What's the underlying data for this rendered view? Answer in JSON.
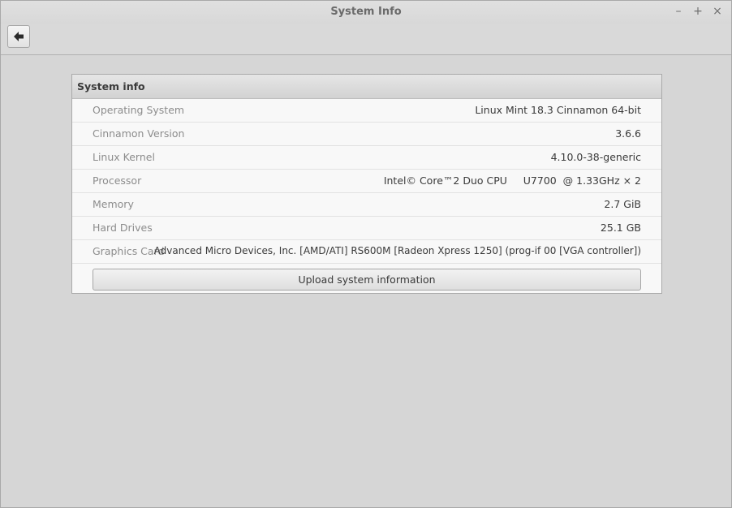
{
  "window": {
    "title": "System Info",
    "controls": {
      "minimize": "–",
      "maximize": "+",
      "close": "×"
    }
  },
  "toolbar": {
    "back_icon": "back-arrow-icon"
  },
  "panel": {
    "header": "System info",
    "rows": [
      {
        "label": "Operating System",
        "value": "Linux Mint 18.3 Cinnamon 64-bit"
      },
      {
        "label": "Cinnamon Version",
        "value": "3.6.6"
      },
      {
        "label": "Linux Kernel",
        "value": "4.10.0-38-generic"
      },
      {
        "label": "Processor",
        "value": "Intel© Core™2 Duo CPU     U7700  @ 1.33GHz × 2"
      },
      {
        "label": "Memory",
        "value": "2.7 GiB"
      },
      {
        "label": "Hard Drives",
        "value": "25.1 GB"
      },
      {
        "label": "Graphics Card",
        "value": "Advanced Micro Devices, Inc. [AMD/ATI] RS600M [Radeon Xpress 1250] (prog-if 00 [VGA controller])"
      }
    ],
    "upload_button": "Upload system information"
  }
}
